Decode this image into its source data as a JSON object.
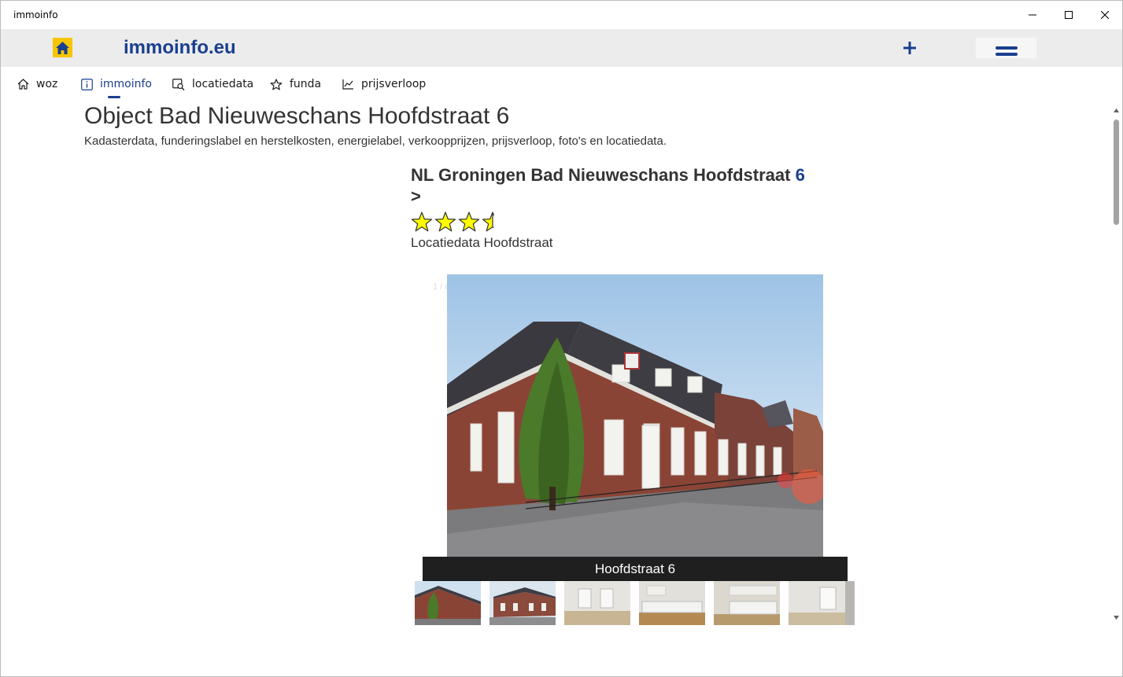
{
  "window": {
    "title": "immoinfo"
  },
  "appbar": {
    "brand": "immoinfo.eu",
    "plus_label": "+"
  },
  "nav": [
    {
      "label": "woz",
      "icon": "home-outline-icon"
    },
    {
      "label": "immoinfo",
      "icon": "info-icon",
      "active": true
    },
    {
      "label": "locatiedata",
      "icon": "map-search-icon"
    },
    {
      "label": "funda",
      "icon": "star-outline-icon"
    },
    {
      "label": "prijsverloop",
      "icon": "line-chart-icon"
    }
  ],
  "page": {
    "title": "Object Bad Nieuweschans Hoofdstraat 6",
    "subtitle": "Kadasterdata, funderingslabel en herstelkosten, energielabel, verkoopprijzen, prijsverloop, foto's en locatiedata."
  },
  "object": {
    "title_prefix": "NL Groningen Bad Nieuweschans Hoofdstraat ",
    "number": "6",
    "arrow": ">",
    "rating": 3.5,
    "rating_max": 4,
    "location_label": "Locatiedata Hoofdstraat"
  },
  "gallery": {
    "counter": "1 / 6",
    "caption": "Hoofdstraat 6",
    "thumb_count": 6
  },
  "colors": {
    "accent": "#1a3f8f",
    "home_button": "#f7c600",
    "star_fill": "#ffff00"
  }
}
